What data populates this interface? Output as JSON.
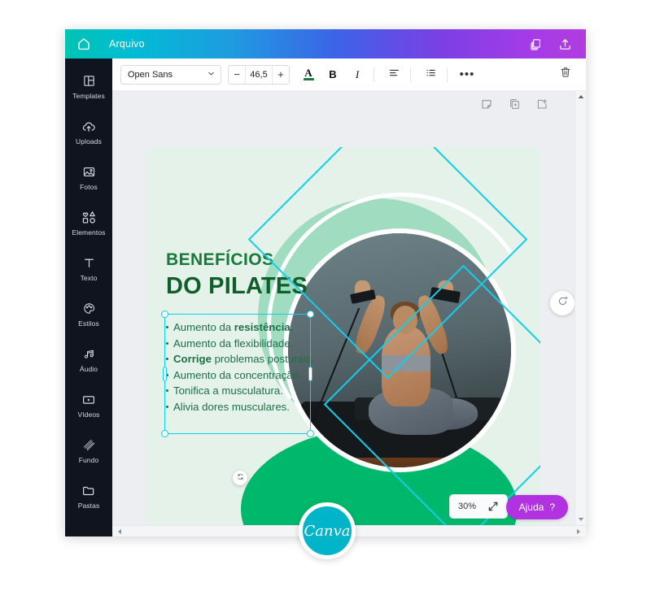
{
  "topbar": {
    "home_icon": "home-icon",
    "file_label": "Arquivo",
    "duplicate_icon": "copy-icon",
    "share_icon": "share-upload-icon"
  },
  "sidebar": {
    "items": [
      {
        "label": "Templates",
        "icon": "templates-icon"
      },
      {
        "label": "Uploads",
        "icon": "cloud-upload-icon"
      },
      {
        "label": "Fotos",
        "icon": "photo-icon"
      },
      {
        "label": "Elementos",
        "icon": "shapes-icon"
      },
      {
        "label": "Texto",
        "icon": "text-t-icon"
      },
      {
        "label": "Estilos",
        "icon": "palette-icon"
      },
      {
        "label": "Áudio",
        "icon": "music-note-icon"
      },
      {
        "label": "Vídeos",
        "icon": "video-play-icon"
      },
      {
        "label": "Fundo",
        "icon": "hatch-pattern-icon"
      },
      {
        "label": "Pastas",
        "icon": "folder-icon"
      }
    ]
  },
  "toolbar": {
    "font_name": "Open Sans",
    "chevron_icon": "chevron-down-icon",
    "decrease_label": "−",
    "font_size": "46,5",
    "increase_label": "+",
    "text_color_label": "A",
    "text_color_swatch": "#1a7a3c",
    "bold_label": "B",
    "italic_label": "I",
    "align_icon": "align-left-icon",
    "list_icon": "bullet-list-icon",
    "more_label": "•••",
    "trash_icon": "trash-icon"
  },
  "page_tools": {
    "note_icon": "sticky-note-icon",
    "duplicate_page_icon": "duplicate-page-icon",
    "add_page_icon": "add-page-icon"
  },
  "design": {
    "title_line1": "BENEFÍCIOS",
    "title_line2": "DO PILATES",
    "bullets": [
      {
        "bold": "",
        "text": "Aumento da ",
        "bold_tail": "resistência.",
        "full": "Aumento da resistência."
      },
      {
        "bold": "",
        "text": "Aumento da flexibilidade.",
        "bold_tail": "",
        "full": "Aumento da flexibilidade."
      },
      {
        "bold": "Corrige",
        "text": " problemas posturais.",
        "bold_tail": "",
        "full": "Corrige problemas posturais."
      },
      {
        "bold": "",
        "text": "Aumento da concentração.",
        "bold_tail": "",
        "full": "Aumento da concentração."
      },
      {
        "bold": "",
        "text": "Tonifica a musculatura.",
        "bold_tail": "",
        "full": "Tonifica a musculatura."
      },
      {
        "bold": "",
        "text": "Alivia dores musculares.",
        "bold_tail": "",
        "full": "Alivia dores musculares."
      }
    ],
    "colors": {
      "background": "#e4f2e9",
      "mint_circle": "#9fdcc0",
      "green_accent": "#00b86b",
      "title_green": "#157a3a",
      "selection_cyan": "#14cdea"
    },
    "photo_alt": "pilates-reformer-photo"
  },
  "selection": {
    "rotate_small_icon": "rotate-icon",
    "rotate_large_icon": "rotate-plus-icon"
  },
  "bottom": {
    "zoom_level": "30%",
    "expand_icon": "expand-arrows-icon",
    "help_label": "Ajuda",
    "help_mark": "?"
  },
  "scrollbars": {
    "up_icon": "triangle-up-icon",
    "down_icon": "triangle-down-icon",
    "left_icon": "triangle-left-icon",
    "right_icon": "triangle-right-icon"
  },
  "branding": {
    "badge_text": "Canva"
  }
}
